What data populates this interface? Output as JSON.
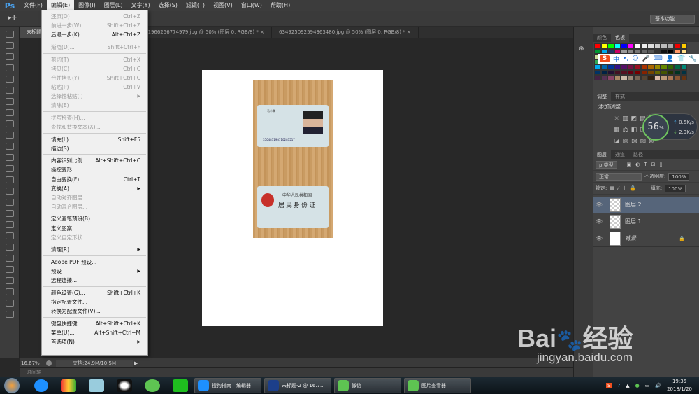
{
  "app": {
    "logo": "Ps"
  },
  "menubar": [
    "文件(F)",
    "编辑(E)",
    "图像(I)",
    "图层(L)",
    "文字(Y)",
    "选择(S)",
    "滤镜(T)",
    "视图(V)",
    "窗口(W)",
    "帮助(H)"
  ],
  "workspace": "基本功能",
  "tabs": [
    {
      "label": "未标题-2 @ 16.7% (图层 2, RGB/8) *",
      "active": true
    },
    {
      "label": "541591966256774979.jpg @ 50% (图层 0, RGB/8) *"
    },
    {
      "label": "634925092594363480.jpg @ 50% (图层 0, RGB/8) *"
    }
  ],
  "edit_menu": [
    [
      {
        "label": "还原(O)",
        "shortcut": "Ctrl+Z",
        "disabled": true
      },
      {
        "label": "前进一步(W)",
        "shortcut": "Shift+Ctrl+Z",
        "disabled": true
      },
      {
        "label": "后退一步(K)",
        "shortcut": "Alt+Ctrl+Z"
      }
    ],
    [
      {
        "label": "渐隐(D)...",
        "shortcut": "Shift+Ctrl+F",
        "disabled": true
      }
    ],
    [
      {
        "label": "剪切(T)",
        "shortcut": "Ctrl+X",
        "disabled": true
      },
      {
        "label": "拷贝(C)",
        "shortcut": "Ctrl+C",
        "disabled": true
      },
      {
        "label": "合并拷贝(Y)",
        "shortcut": "Shift+Ctrl+C",
        "disabled": true
      },
      {
        "label": "粘贴(P)",
        "shortcut": "Ctrl+V",
        "disabled": true
      },
      {
        "label": "选择性粘贴(I)",
        "submenu": true,
        "disabled": true
      },
      {
        "label": "清除(E)",
        "disabled": true
      }
    ],
    [
      {
        "label": "拼写检查(H)...",
        "disabled": true
      },
      {
        "label": "查找和替换文本(X)...",
        "disabled": true
      }
    ],
    [
      {
        "label": "填充(L)...",
        "shortcut": "Shift+F5"
      },
      {
        "label": "描边(S)..."
      }
    ],
    [
      {
        "label": "内容识别比例",
        "shortcut": "Alt+Shift+Ctrl+C"
      },
      {
        "label": "操控变形"
      },
      {
        "label": "自由变换(F)",
        "shortcut": "Ctrl+T"
      },
      {
        "label": "变换(A)",
        "submenu": true
      },
      {
        "label": "自动对齐图层...",
        "disabled": true
      },
      {
        "label": "自动混合图层...",
        "disabled": true
      }
    ],
    [
      {
        "label": "定义画笔预设(B)..."
      },
      {
        "label": "定义图案..."
      },
      {
        "label": "定义自定形状...",
        "disabled": true
      }
    ],
    [
      {
        "label": "清理(R)",
        "submenu": true
      }
    ],
    [
      {
        "label": "Adobe PDF 预设..."
      },
      {
        "label": "预设",
        "submenu": true
      },
      {
        "label": "远程连接..."
      }
    ],
    [
      {
        "label": "颜色设置(G)...",
        "shortcut": "Shift+Ctrl+K"
      },
      {
        "label": "指定配置文件..."
      },
      {
        "label": "转换为配置文件(V)..."
      }
    ],
    [
      {
        "label": "键盘快捷键...",
        "shortcut": "Alt+Shift+Ctrl+K"
      },
      {
        "label": "菜单(U)...",
        "shortcut": "Alt+Shift+Ctrl+M"
      },
      {
        "label": "首选项(N)",
        "submenu": true
      }
    ]
  ],
  "id_card": {
    "number": "350481198710287517",
    "name": "马小腾",
    "country": "中华人民共和国",
    "title": "居民身份证"
  },
  "status": {
    "zoom": "16.67%",
    "doc": "文档:24.9M/10.5M",
    "timeline": "时间轴"
  },
  "swatch_panel": {
    "tabs": [
      "颜色",
      "色板"
    ]
  },
  "ime": {
    "logo": "S",
    "mode": "中",
    "punct": "•,"
  },
  "adjust_panel": {
    "tabs": [
      "调整",
      "样式"
    ],
    "title": "添加调整"
  },
  "speed_widget": {
    "percent": "56",
    "unit": "%",
    "up": "0.5K/s",
    "down": "2.9K/s"
  },
  "layers_panel": {
    "tabs": [
      "图层",
      "通道",
      "路径"
    ],
    "filter": "ρ 类型",
    "blend": "正常",
    "opacity_label": "不透明度:",
    "opacity": "100%",
    "lock_label": "锁定:",
    "fill_label": "填充:",
    "fill": "100%",
    "layers": [
      {
        "name": "图层 2",
        "selected": true
      },
      {
        "name": "图层 1"
      },
      {
        "name": "背景",
        "locked": true
      }
    ]
  },
  "taskbar": {
    "buttons": [
      "搜狗指南—编辑器",
      "未标题-2 @ 16.7...",
      "微信",
      "图片查看器"
    ],
    "time": "19:35",
    "date": "2018/1/20"
  },
  "watermark": {
    "big": "Bai百经验",
    "small": "jingyan.baidu.com"
  }
}
